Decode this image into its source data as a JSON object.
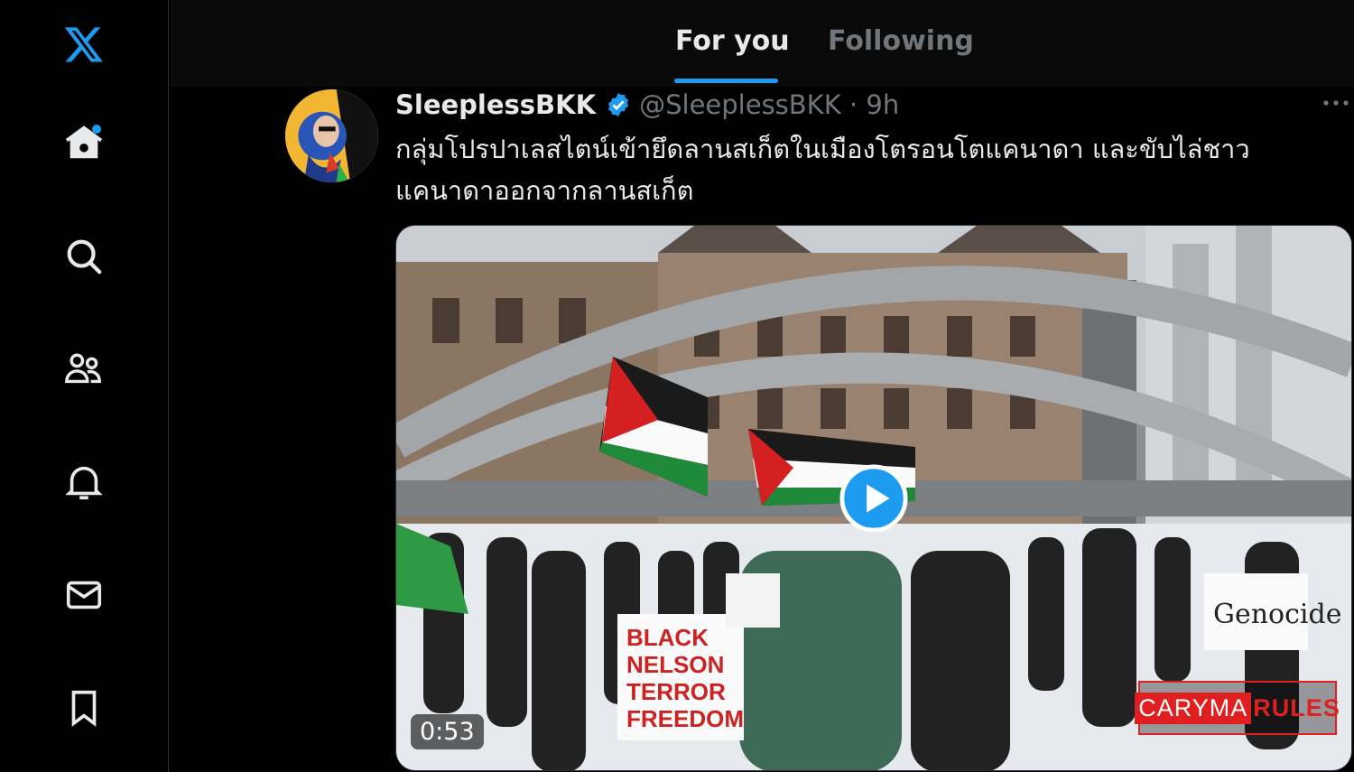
{
  "topbar": {
    "tabs": [
      {
        "label": "For you"
      },
      {
        "label": "Following"
      }
    ]
  },
  "tweet": {
    "display_name": "SleeplessBKK",
    "handle_time": "@SleeplessBKK · 9h",
    "text": "กลุ่มโปรปาเลสไตน์เข้ายึดลานสเก็ตในเมืองโตรอนโตแคนาดา และขับไล่ชาวแคนาดาออกจากลานสเก็ต",
    "video": {
      "duration": "0:53",
      "watermark_a": "CARYMA",
      "watermark_b": "RULES"
    }
  },
  "sidebar": {
    "icons": [
      "x-logo-icon",
      "home-icon",
      "search-icon",
      "communities-icon",
      "notifications-icon",
      "messages-icon",
      "bookmarks-icon"
    ]
  },
  "colors": {
    "accent": "#1d9bf0",
    "background": "#000000",
    "muted": "#71767b"
  }
}
